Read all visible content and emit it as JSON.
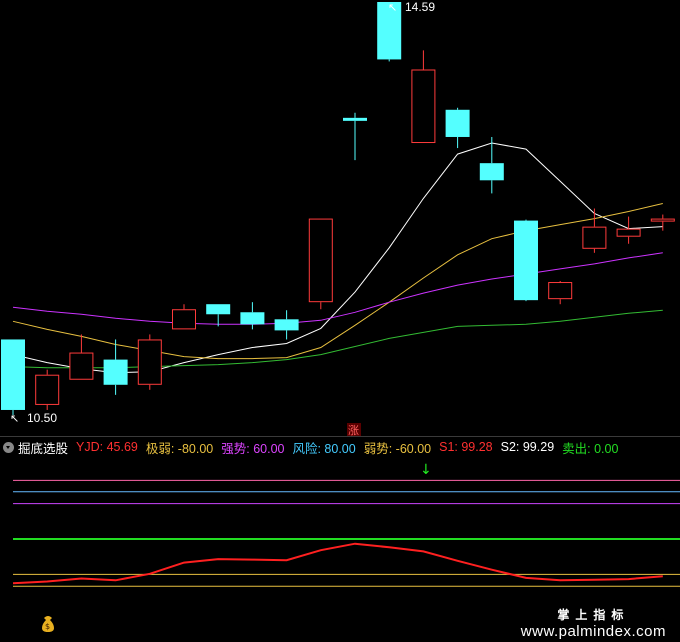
{
  "main_chart": {
    "high_label": "14.59",
    "low_label": "10.50",
    "limit_up_badge": "涨",
    "colors": {
      "up": "#ff3b3b",
      "down": "#54ffff",
      "ma5": "#ffffff",
      "ma10": "#e8c040",
      "ma20": "#cc33ff",
      "ma60": "#33bb33"
    }
  },
  "indicator": {
    "name": "掘底选股",
    "items": [
      {
        "text": "YJD: 45.69",
        "color": "#ff3030"
      },
      {
        "text": "极弱: -80.00",
        "color": "#e8c040"
      },
      {
        "text": "强势: 60.00",
        "color": "#dd44ff"
      },
      {
        "text": "风险: 80.00",
        "color": "#44ccff"
      },
      {
        "text": "弱势: -60.00",
        "color": "#e8c040"
      },
      {
        "text": "S1: 99.28",
        "color": "#ff3030"
      },
      {
        "text": "S2: 99.29",
        "color": "#ffffff"
      },
      {
        "text": "卖出: 0.00",
        "color": "#22dd22"
      }
    ]
  },
  "chart_data": [
    {
      "type": "candlestick",
      "ohlc": [
        {
          "o": 11.25,
          "h": 11.25,
          "l": 10.5,
          "c": 10.55
        },
        {
          "o": 10.6,
          "h": 10.95,
          "l": 10.55,
          "c": 10.9
        },
        {
          "o": 10.85,
          "h": 11.3,
          "l": 10.85,
          "c": 11.12
        },
        {
          "o": 11.05,
          "h": 11.25,
          "l": 10.7,
          "c": 10.8
        },
        {
          "o": 10.8,
          "h": 11.3,
          "l": 10.75,
          "c": 11.25
        },
        {
          "o": 11.35,
          "h": 11.6,
          "l": 11.35,
          "c": 11.55
        },
        {
          "o": 11.6,
          "h": 11.6,
          "l": 11.38,
          "c": 11.5
        },
        {
          "o": 11.52,
          "h": 11.62,
          "l": 11.35,
          "c": 11.4
        },
        {
          "o": 11.45,
          "h": 11.54,
          "l": 11.25,
          "c": 11.34
        },
        {
          "o": 11.62,
          "h": 12.45,
          "l": 11.55,
          "c": 12.45
        },
        {
          "o": 13.45,
          "h": 13.5,
          "l": 13.03,
          "c": 13.42
        },
        {
          "o": 14.6,
          "h": 14.6,
          "l": 14.01,
          "c": 14.03
        },
        {
          "o": 13.2,
          "h": 14.12,
          "l": 13.2,
          "c": 13.93
        },
        {
          "o": 13.53,
          "h": 13.55,
          "l": 13.15,
          "c": 13.26
        },
        {
          "o": 13.0,
          "h": 13.26,
          "l": 12.7,
          "c": 12.83
        },
        {
          "o": 12.43,
          "h": 12.44,
          "l": 11.63,
          "c": 11.64
        },
        {
          "o": 11.65,
          "h": 11.83,
          "l": 11.6,
          "c": 11.82
        },
        {
          "o": 12.15,
          "h": 12.55,
          "l": 12.11,
          "c": 12.37
        },
        {
          "o": 12.27,
          "h": 12.47,
          "l": 12.2,
          "c": 12.35
        },
        {
          "o": 12.42,
          "h": 12.49,
          "l": 12.33,
          "c": 12.45
        }
      ],
      "ma_lines": [
        {
          "name": "MA5",
          "values": [
            11.1,
            11.02,
            10.96,
            10.92,
            10.93,
            11.02,
            11.1,
            11.17,
            11.21,
            11.36,
            11.72,
            12.16,
            12.65,
            13.09,
            13.2,
            13.14,
            12.82,
            12.5,
            12.35,
            12.37
          ]
        },
        {
          "name": "MA10",
          "values": [
            11.43,
            11.35,
            11.28,
            11.2,
            11.14,
            11.08,
            11.06,
            11.06,
            11.07,
            11.17,
            11.39,
            11.62,
            11.86,
            12.09,
            12.25,
            12.33,
            12.39,
            12.45,
            12.52,
            12.6
          ]
        },
        {
          "name": "MA20",
          "values": [
            11.57,
            11.53,
            11.5,
            11.46,
            11.43,
            11.41,
            11.4,
            11.4,
            11.41,
            11.44,
            11.52,
            11.62,
            11.71,
            11.79,
            11.85,
            11.9,
            11.95,
            12.0,
            12.06,
            12.11
          ]
        },
        {
          "name": "MA60",
          "values": [
            10.98,
            10.97,
            10.97,
            10.97,
            10.98,
            10.99,
            11.0,
            11.02,
            11.05,
            11.1,
            11.18,
            11.26,
            11.32,
            11.38,
            11.39,
            11.4,
            11.43,
            11.47,
            11.51,
            11.54
          ]
        }
      ]
    },
    {
      "type": "line",
      "series": [
        {
          "name": "YJD",
          "x": [
            0,
            1,
            2,
            3,
            4,
            5,
            6,
            7,
            8,
            9,
            10,
            11,
            12,
            13,
            14,
            15,
            16,
            17,
            18,
            19
          ],
          "values": [
            -75,
            -72,
            -67,
            -70,
            -59,
            -40,
            -34,
            -35,
            -36,
            -19,
            -8,
            -14,
            -21,
            -37,
            -52,
            -66,
            -70,
            -69,
            -68,
            -63
          ]
        }
      ],
      "reference_lines": [
        {
          "name": "S1",
          "value": 99.28
        },
        {
          "name": "风险",
          "value": 80.0
        },
        {
          "name": "强势",
          "value": 60.0
        },
        {
          "name": "卖出",
          "value": 0.0
        },
        {
          "name": "弱势",
          "value": -60.0
        },
        {
          "name": "极弱",
          "value": -80.0
        }
      ],
      "sell_arrow_index": 12
    }
  ],
  "watermark": {
    "cn": "掌上指标",
    "url": "www.palmindex.com"
  }
}
